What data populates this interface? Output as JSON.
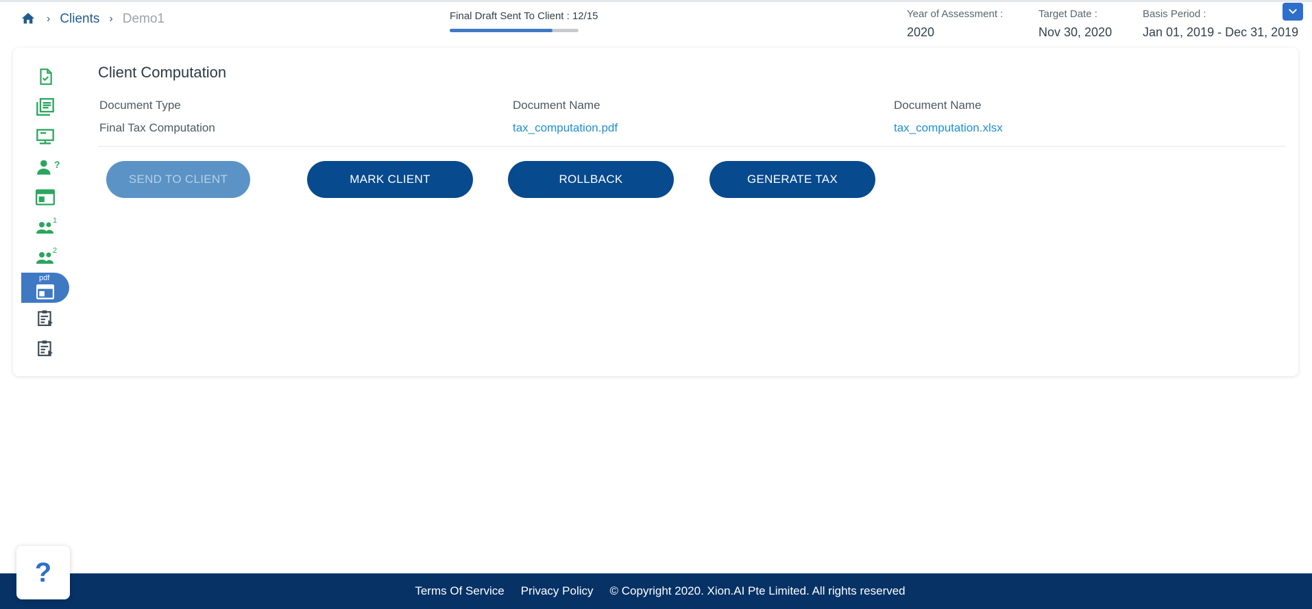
{
  "breadcrumb": {
    "home_icon": "home-icon",
    "items": [
      {
        "label": "Clients"
      },
      {
        "label": "Demo1"
      }
    ]
  },
  "progress": {
    "label": "Final Draft Sent To Client : 12/15",
    "completed": 12,
    "total": 15
  },
  "meta": {
    "year_of_assessment": {
      "label": "Year of Assessment :",
      "value": "2020"
    },
    "target_date": {
      "label": "Target Date :",
      "value": "Nov 30, 2020"
    },
    "basis_period": {
      "label": "Basis Period :",
      "value": "Jan 01, 2019 - Dec 31, 2019"
    }
  },
  "side_nav": {
    "items": [
      {
        "icon": "document-check-icon"
      },
      {
        "icon": "document-list-icon"
      },
      {
        "icon": "monitor-icon"
      },
      {
        "icon": "user-question-icon",
        "sup": "?"
      },
      {
        "icon": "layout-icon"
      },
      {
        "icon": "users-icon",
        "sup": "1"
      },
      {
        "icon": "users-icon",
        "sup": "2"
      },
      {
        "icon": "pdf-layout-icon",
        "tag": "pdf",
        "active": true
      },
      {
        "icon": "clipboard-play-icon"
      },
      {
        "icon": "clipboard-play-icon"
      }
    ]
  },
  "main": {
    "title": "Client Computation",
    "columns": [
      {
        "header": "Document Type",
        "value": "Final Tax Computation"
      },
      {
        "header": "Document Name",
        "value": "tax_computation.pdf"
      },
      {
        "header": "Document Name",
        "value": "tax_computation.xlsx"
      }
    ],
    "buttons": {
      "send_to_client": "SEND TO CLIENT",
      "mark_client": "MARK CLIENT",
      "rollback": "ROLLBACK",
      "generate_tax": "GENERATE TAX"
    }
  },
  "help": {
    "label": "?"
  },
  "footer": {
    "terms": "Terms Of Service",
    "privacy": "Privacy Policy",
    "copyright": "© Copyright 2020. Xion.AI Pte Limited. All rights reserved"
  },
  "colors": {
    "primary": "#074a8e",
    "accent": "#2d6fcb",
    "nav_icon": "#2aa65e",
    "link": "#1e8fd0",
    "footer": "#063266"
  }
}
